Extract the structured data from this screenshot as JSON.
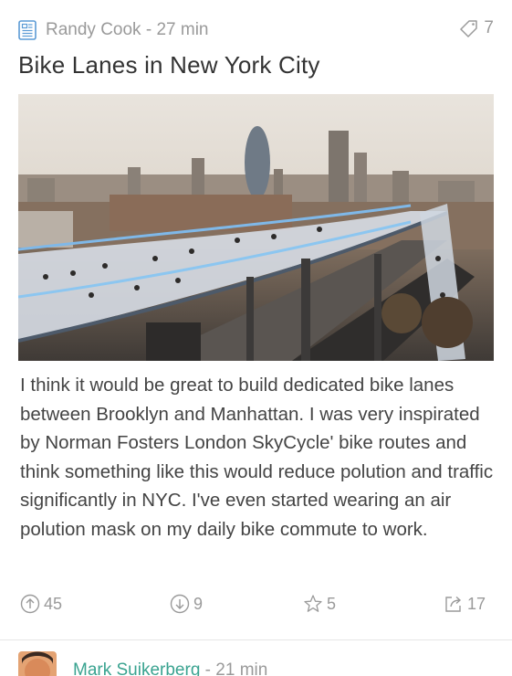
{
  "post": {
    "author": "Randy Cook",
    "separator": " - ",
    "time": "27 min",
    "tag_count": "7",
    "title": "Bike Lanes in New York City",
    "body": "I think it would be great to build dedicated bike lanes between Brooklyn and Manhattan. I was very inspirated by Norman Fosters London SkyCycle' bike routes and think something like this would reduce polution and traffic significantly in NYC. I've even started wearing an air polution mask on my daily bike commute to work.",
    "actions": {
      "upvotes": "45",
      "downvotes": "9",
      "favorites": "5",
      "shares": "17"
    }
  },
  "next_post": {
    "author": "Mark Suikerberg",
    "separator": " - ",
    "time": "21 min"
  },
  "colors": {
    "icon_blue": "#5b9bd5",
    "meta_gray": "#9a9a9a",
    "author_green": "#3aa390"
  },
  "icons": [
    "document-icon",
    "tag-icon",
    "upvote-icon",
    "downvote-icon",
    "star-icon",
    "share-icon"
  ]
}
